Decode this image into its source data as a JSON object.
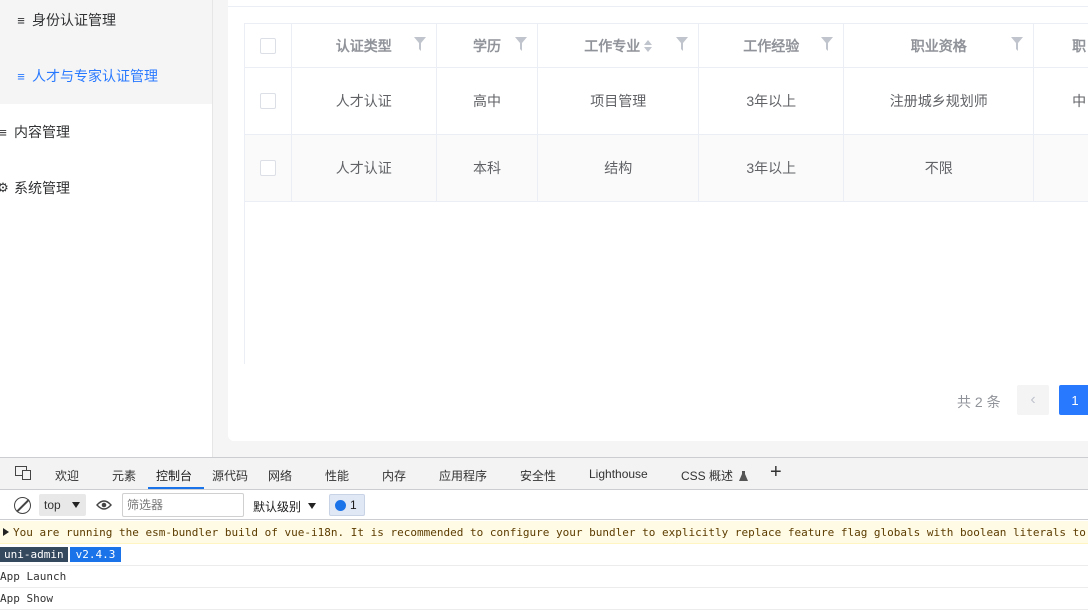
{
  "sidebar": {
    "items": [
      {
        "label": "身份认证管理",
        "icon": "≡"
      },
      {
        "label": "人才与专家认证管理",
        "icon": "≡"
      },
      {
        "label": "内容管理",
        "icon": "≡"
      },
      {
        "label": "系统管理",
        "icon": "⚙"
      }
    ]
  },
  "table": {
    "headers": [
      "认证类型",
      "学历",
      "工作专业",
      "工作经验",
      "职业资格",
      "职"
    ],
    "rows": [
      [
        "人才认证",
        "高中",
        "项目管理",
        "3年以上",
        "注册城乡规划师",
        "中"
      ],
      [
        "人才认证",
        "本科",
        "结构",
        "3年以上",
        "不限",
        ""
      ]
    ]
  },
  "pagination": {
    "total": "共 2 条",
    "prev": "‹",
    "page": "1"
  },
  "devtools": {
    "tabs": [
      "欢迎",
      "元素",
      "控制台",
      "源代码",
      "网络",
      "性能",
      "内存",
      "应用程序",
      "安全性",
      "Lighthouse",
      "CSS 概述"
    ],
    "plus": "+",
    "context": "top",
    "filter_placeholder": "筛选器",
    "level": "默认级别",
    "issues_count": "1",
    "console": {
      "warning": "You are running the esm-bundler build of vue-i18n. It is recommended to configure your bundler to explicitly replace feature flag globals with boolean literals to",
      "tag_name": "uni-admin",
      "tag_version": "v2.4.3",
      "line3": "App Launch",
      "line4": "App Show"
    }
  },
  "colors": {
    "accent": "#2979ff",
    "devtools_blue": "#1a73e8"
  }
}
